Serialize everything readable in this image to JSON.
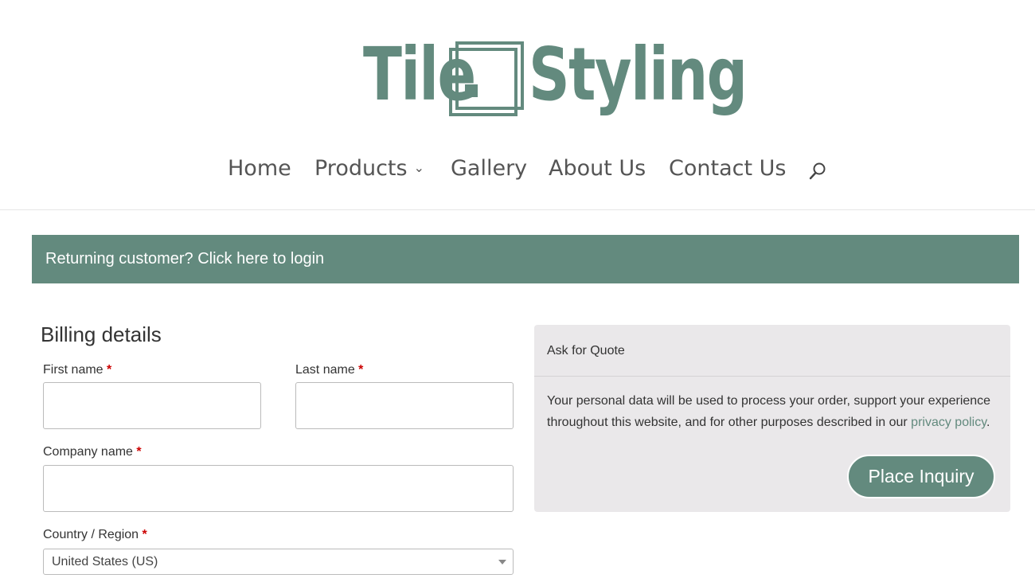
{
  "logo": {
    "word_left": "Tile",
    "word_right": "Styling"
  },
  "nav": {
    "items": [
      "Home",
      "Products",
      "Gallery",
      "About Us",
      "Contact Us"
    ],
    "dropdown_chevron": "›",
    "search_icon": "search-icon"
  },
  "notice": {
    "text": "Returning customer? Click here to login"
  },
  "billing": {
    "title": "Billing details",
    "first_name_label": "First name",
    "last_name_label": "Last name",
    "company_label": "Company name",
    "country_label": "Country / Region",
    "country_value": "United States (US)",
    "required_marker": "*"
  },
  "quote": {
    "title": "Ask for Quote",
    "privacy_text_before": "Your personal data will be used to process your order, support your experience throughout this website, and for other purposes described in our ",
    "privacy_link": "privacy policy",
    "privacy_text_after": ".",
    "button": "Place Inquiry"
  },
  "colors": {
    "brand": "#638a7e",
    "panel": "#eae8ea",
    "required": "#cc0000"
  }
}
